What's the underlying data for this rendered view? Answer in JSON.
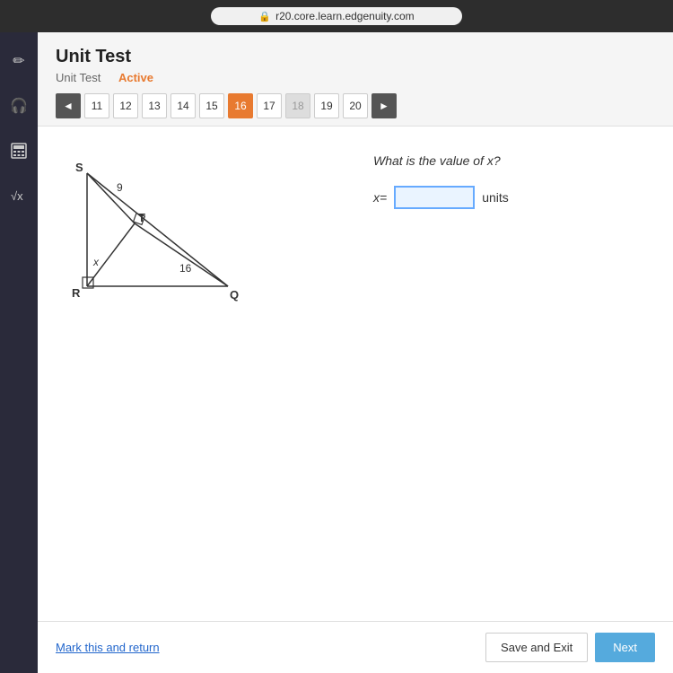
{
  "browser": {
    "url": "r20.core.learn.edgenuity.com",
    "lock_symbol": "🔒"
  },
  "page": {
    "title": "Unit Test",
    "breadcrumb_item1": "Unit Test",
    "breadcrumb_item2": "Active"
  },
  "navigation": {
    "prev_arrow": "◄",
    "next_arrow": "►",
    "questions": [
      "11",
      "12",
      "13",
      "14",
      "15",
      "16",
      "17",
      "18",
      "19",
      "20"
    ],
    "active_question": "16"
  },
  "sidebar": {
    "icons": [
      {
        "name": "pencil-icon",
        "symbol": "✏"
      },
      {
        "name": "headphone-icon",
        "symbol": "🎧"
      },
      {
        "name": "calculator-icon",
        "symbol": "⊞"
      },
      {
        "name": "formula-icon",
        "symbol": "√x"
      }
    ]
  },
  "diagram": {
    "label_s": "S",
    "label_t": "T",
    "label_r": "R",
    "label_q": "Q",
    "label_x": "x",
    "value_9": "9",
    "value_16": "16"
  },
  "question": {
    "text": "What is the value of x?",
    "answer_label": "x=",
    "answer_value": "",
    "answer_placeholder": "",
    "answer_unit": "units"
  },
  "footer": {
    "mark_return_label": "Mark this and return",
    "save_exit_label": "Save and Exit",
    "next_label": "Next"
  }
}
